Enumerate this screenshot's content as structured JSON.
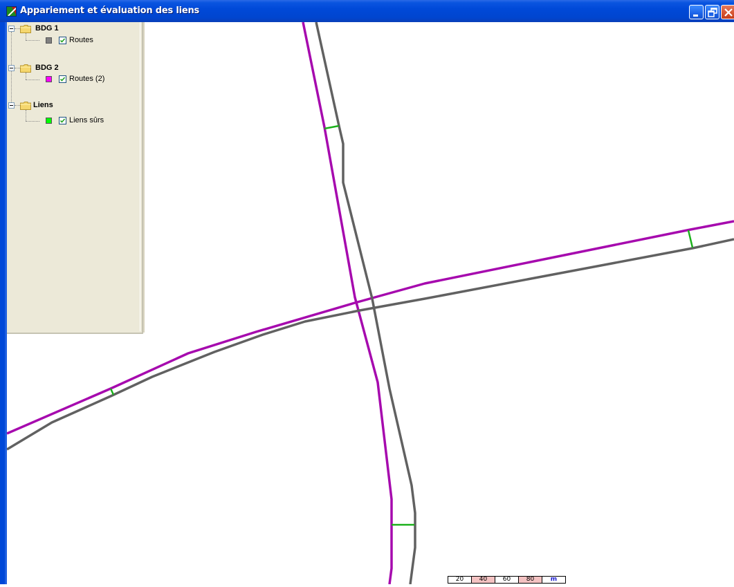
{
  "window": {
    "title": "Appariement et évaluation des liens",
    "controls": [
      "minimize",
      "restore",
      "close"
    ]
  },
  "layers": [
    {
      "group": "BDG 1",
      "items": [
        {
          "label": "Routes",
          "color": "#808080",
          "checked": true
        }
      ]
    },
    {
      "group": "BDG 2",
      "items": [
        {
          "label": "Routes (2)",
          "color": "#ff00ff",
          "checked": true
        }
      ]
    },
    {
      "group": "Liens",
      "items": [
        {
          "label": "Liens sûrs",
          "color": "#00ff00",
          "checked": true
        }
      ]
    }
  ],
  "map": {
    "colors": {
      "bdg1_roads": "#616161",
      "bdg2_roads": "#a60aae",
      "links": "#1bb01b"
    }
  },
  "scale_bar": {
    "labels": [
      "20",
      "40",
      "60",
      "80",
      "m"
    ],
    "unit": "m"
  }
}
